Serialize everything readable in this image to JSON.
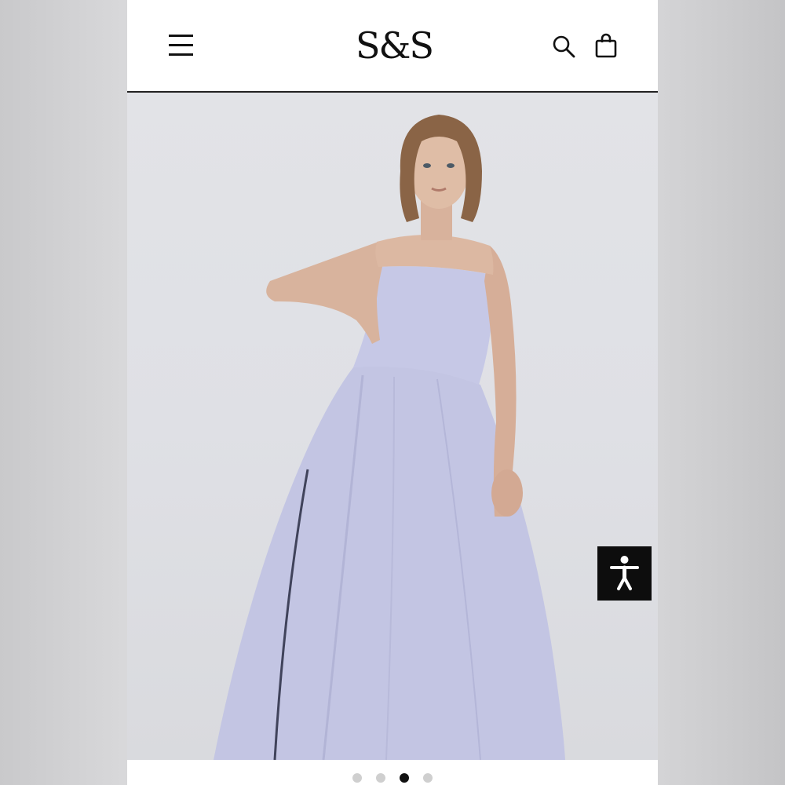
{
  "header": {
    "logo_text": "S&S",
    "menu_icon": "hamburger-menu-icon",
    "search_icon": "search-icon",
    "bag_icon": "shopping-bag-icon"
  },
  "hero": {
    "product_color": "#c3c5e3"
  },
  "accessibility": {
    "icon": "accessibility-person-icon"
  },
  "carousel": {
    "slide_count": 4,
    "active_index": 2
  }
}
